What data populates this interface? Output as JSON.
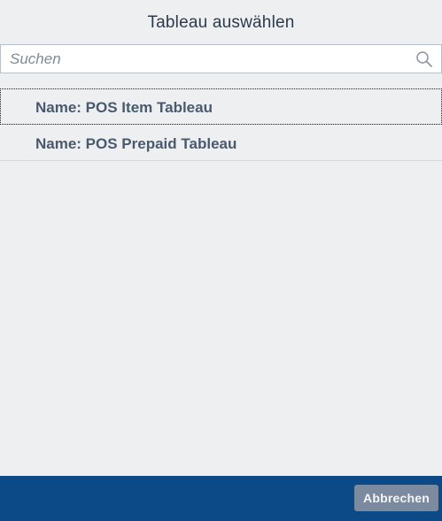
{
  "dialog": {
    "title": "Tableau auswählen"
  },
  "search": {
    "placeholder": "Suchen",
    "value": ""
  },
  "list": {
    "items": [
      {
        "label": "Name: POS Item Tableau",
        "focused": true
      },
      {
        "label": "Name: POS Prepaid Tableau",
        "focused": false
      }
    ]
  },
  "footer": {
    "cancel_label": "Abbrechen"
  },
  "colors": {
    "background": "#eeeff1",
    "footer": "#0b4a87",
    "cancel_button": "#7c8aa0",
    "item_text": "#4a5a6e"
  },
  "icons": {
    "search": "search-icon"
  }
}
